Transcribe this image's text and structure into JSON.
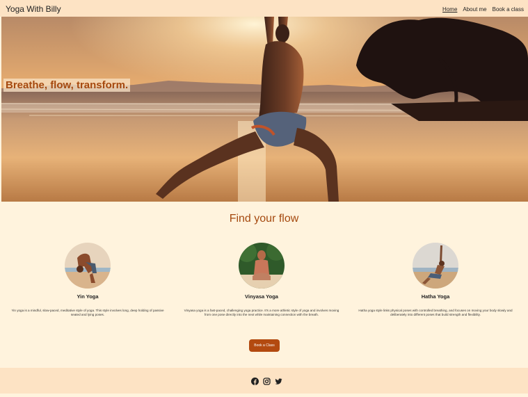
{
  "header": {
    "brand": "Yoga With Billy",
    "nav": [
      {
        "label": "Home",
        "active": true
      },
      {
        "label": "About me",
        "active": false
      },
      {
        "label": "Book a class",
        "active": false
      }
    ]
  },
  "hero": {
    "tagline": "Breathe, flow, transform."
  },
  "main": {
    "title": "Find your flow",
    "cards": [
      {
        "name": "Yin Yoga",
        "description": "Yin yoga is a mindful, slow-paced, meditative style of yoga. This style involves long, deep holding of passive seated and lying poses."
      },
      {
        "name": "Vinyasa Yoga",
        "description": "Vinyasa yoga is a fast-paced, challenging yoga practice. It's a more athletic style of yoga and involves moving from one pose directly into the next while maintaining connection with the breath."
      },
      {
        "name": "Hatha Yoga",
        "description": "Hatha yoga style links physical poses with controlled breathing, and focuses on moving your body slowly and deliberately into different poses that build strength and flexibility."
      }
    ],
    "cta_label": "Book a Class"
  },
  "footer": {
    "social": [
      "facebook-icon",
      "instagram-icon",
      "twitter-icon"
    ]
  },
  "colors": {
    "accent": "#a5490f",
    "button": "#b34a10",
    "header_bg": "#fde3c4",
    "page_bg": "#fff3dd"
  }
}
